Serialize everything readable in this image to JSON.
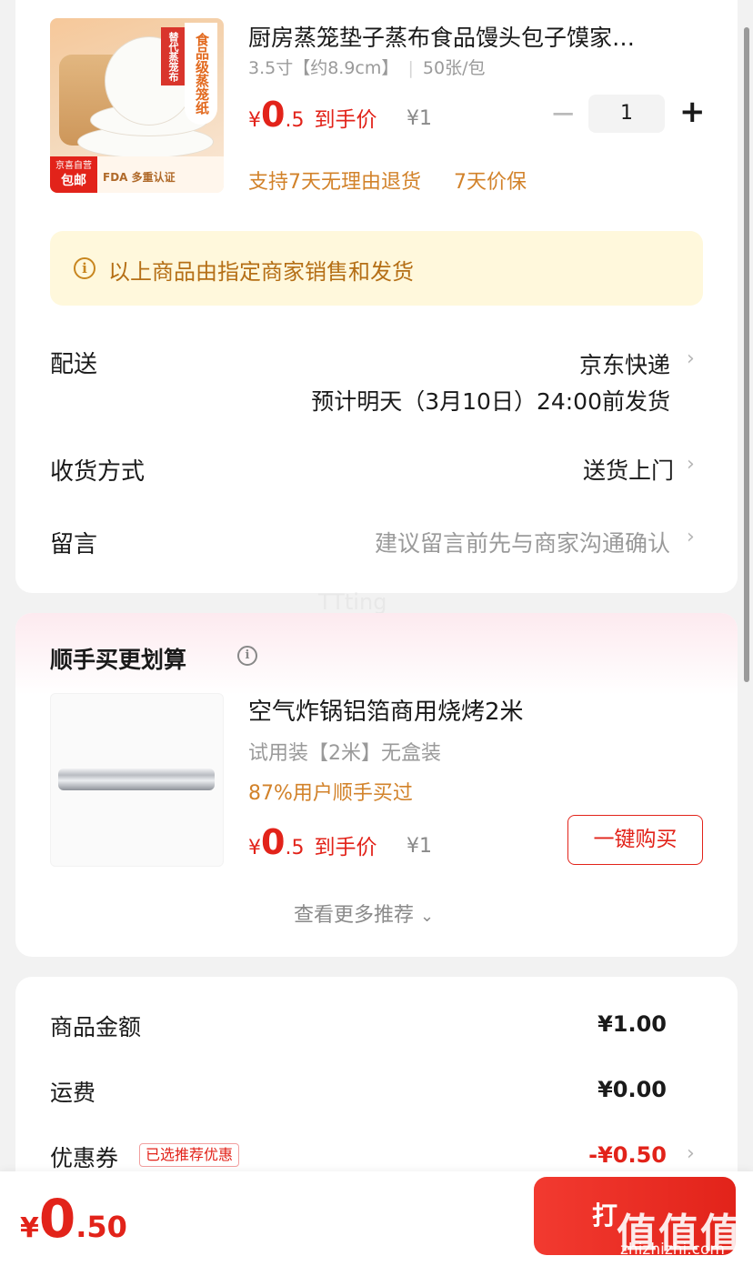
{
  "product": {
    "title": "厨房蒸笼垫子蒸布食品馒头包子馍家…",
    "spec_size": "3.5寸【约8.9cm】",
    "spec_divider": "|",
    "spec_count": "50张/包",
    "image_banner": "食品级蒸笼纸",
    "image_red_tag": "替代蒸笼布",
    "image_badge_top": "京喜自营",
    "image_badge_bottom": "包邮",
    "image_cert": "FDA 多重认证",
    "price_symbol": "¥",
    "price_int": "0",
    "price_dec": ".5",
    "price_label": "到手价",
    "orig_price": "¥1",
    "qty": "1",
    "minus": "−",
    "plus": "+",
    "service_1": "支持7天无理由退货",
    "service_2": "7天价保"
  },
  "notice": {
    "icon": "i",
    "text": "以上商品由指定商家销售和发货"
  },
  "delivery": {
    "label": "配送",
    "value": "京东快递",
    "eta": "预计明天（3月10日）24:00前发货"
  },
  "receive": {
    "label": "收货方式",
    "value": "送货上门"
  },
  "message": {
    "label": "留言",
    "placeholder": "建议留言前先与商家沟通确认"
  },
  "chevron": "›",
  "watermark_text": "TTting",
  "bundle": {
    "title": "顺手买更划算",
    "info_icon": "i",
    "item_title": "空气炸锅铝箔商用烧烤2米",
    "item_spec": "试用装【2米】无盒装",
    "item_social": "87%用户顺手买过",
    "price_symbol": "¥",
    "price_int": "0",
    "price_dec": ".5",
    "price_label": "到手价",
    "orig_price": "¥1",
    "buy_label": "一键购买",
    "more_label": "查看更多推荐",
    "more_chevron": "⌄"
  },
  "summary": {
    "goods_label": "商品金额",
    "goods_value": "¥1.00",
    "shipping_label": "运费",
    "shipping_value": "¥0.00",
    "coupon_label": "优惠券",
    "coupon_tag": "已选推荐优惠",
    "coupon_value": "-¥0.50"
  },
  "footer": {
    "total_symbol": "¥",
    "total_int": "0",
    "total_dec": ".50",
    "pay_label": "打",
    "brand_wm": "值值值",
    "brand_url": "zhizhizhi.com"
  },
  "colors": {
    "accent_red": "#e2231a",
    "accent_orange": "#d2822a",
    "notice_bg": "#fff8dc"
  }
}
